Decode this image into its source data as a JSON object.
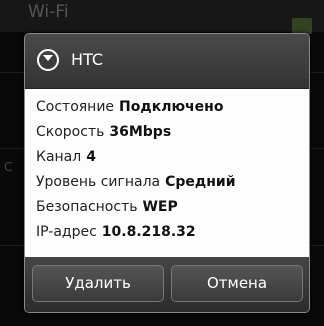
{
  "background": {
    "title": "Wi-Fi",
    "side_letter": "С"
  },
  "dialog": {
    "title": "HTC",
    "rows": [
      {
        "label": "Состояние",
        "value": "Подключено"
      },
      {
        "label": "Скорость",
        "value": "36Mbps"
      },
      {
        "label": "Канал",
        "value": "4"
      },
      {
        "label": "Уровень сигнала",
        "value": "Средний"
      },
      {
        "label": "Безопасность",
        "value": "WEP"
      },
      {
        "label": "IP-адрес",
        "value": "10.8.218.32"
      }
    ],
    "buttons": {
      "delete": "Удалить",
      "cancel": "Отмена"
    }
  },
  "colors": {
    "accent_check": "#5c7a3e",
    "dialog_body": "#fdfdfd"
  }
}
